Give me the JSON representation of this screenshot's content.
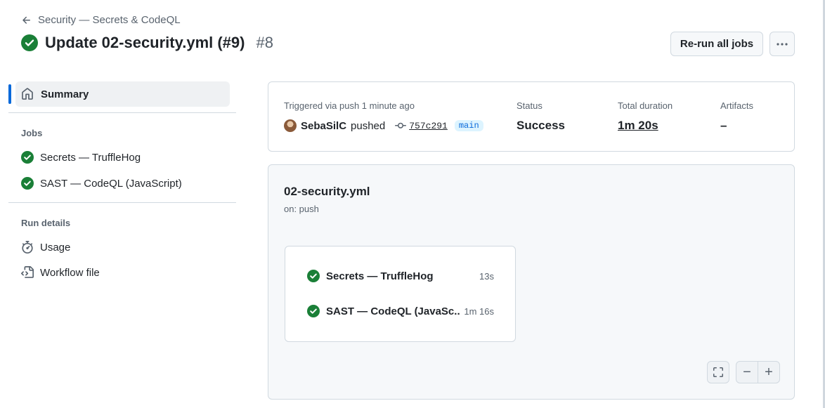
{
  "header": {
    "back_label": "Security — Secrets & CodeQL",
    "title": "Update 02-security.yml (#9)",
    "run_number": "#8",
    "rerun_label": "Re-run all jobs",
    "more_label": "···"
  },
  "sidebar": {
    "summary_label": "Summary",
    "jobs_heading": "Jobs",
    "jobs": [
      {
        "label": "Secrets — TruffleHog"
      },
      {
        "label": "SAST — CodeQL (JavaScript)"
      }
    ],
    "run_details_heading": "Run details",
    "details": [
      {
        "label": "Usage"
      },
      {
        "label": "Workflow file"
      }
    ]
  },
  "summary": {
    "trigger_label": "Triggered via push 1 minute ago",
    "actor": "SebaSilC",
    "action": "pushed",
    "commit_sha": "757c291",
    "branch": "main",
    "status_label": "Status",
    "status_value": "Success",
    "duration_label": "Total duration",
    "duration_value": "1m 20s",
    "artifacts_label": "Artifacts",
    "artifacts_value": "–"
  },
  "graph": {
    "workflow_name": "02-security.yml",
    "trigger": "on: push",
    "jobs": [
      {
        "label": "Secrets — TruffleHog",
        "time": "13s"
      },
      {
        "label": "SAST — CodeQL (JavaSc...",
        "time": "1m 16s"
      }
    ],
    "zoom_out_label": "−",
    "zoom_in_label": "+"
  },
  "colors": {
    "success": "#1a7f37",
    "accent": "#0969da",
    "muted": "#59636e"
  }
}
